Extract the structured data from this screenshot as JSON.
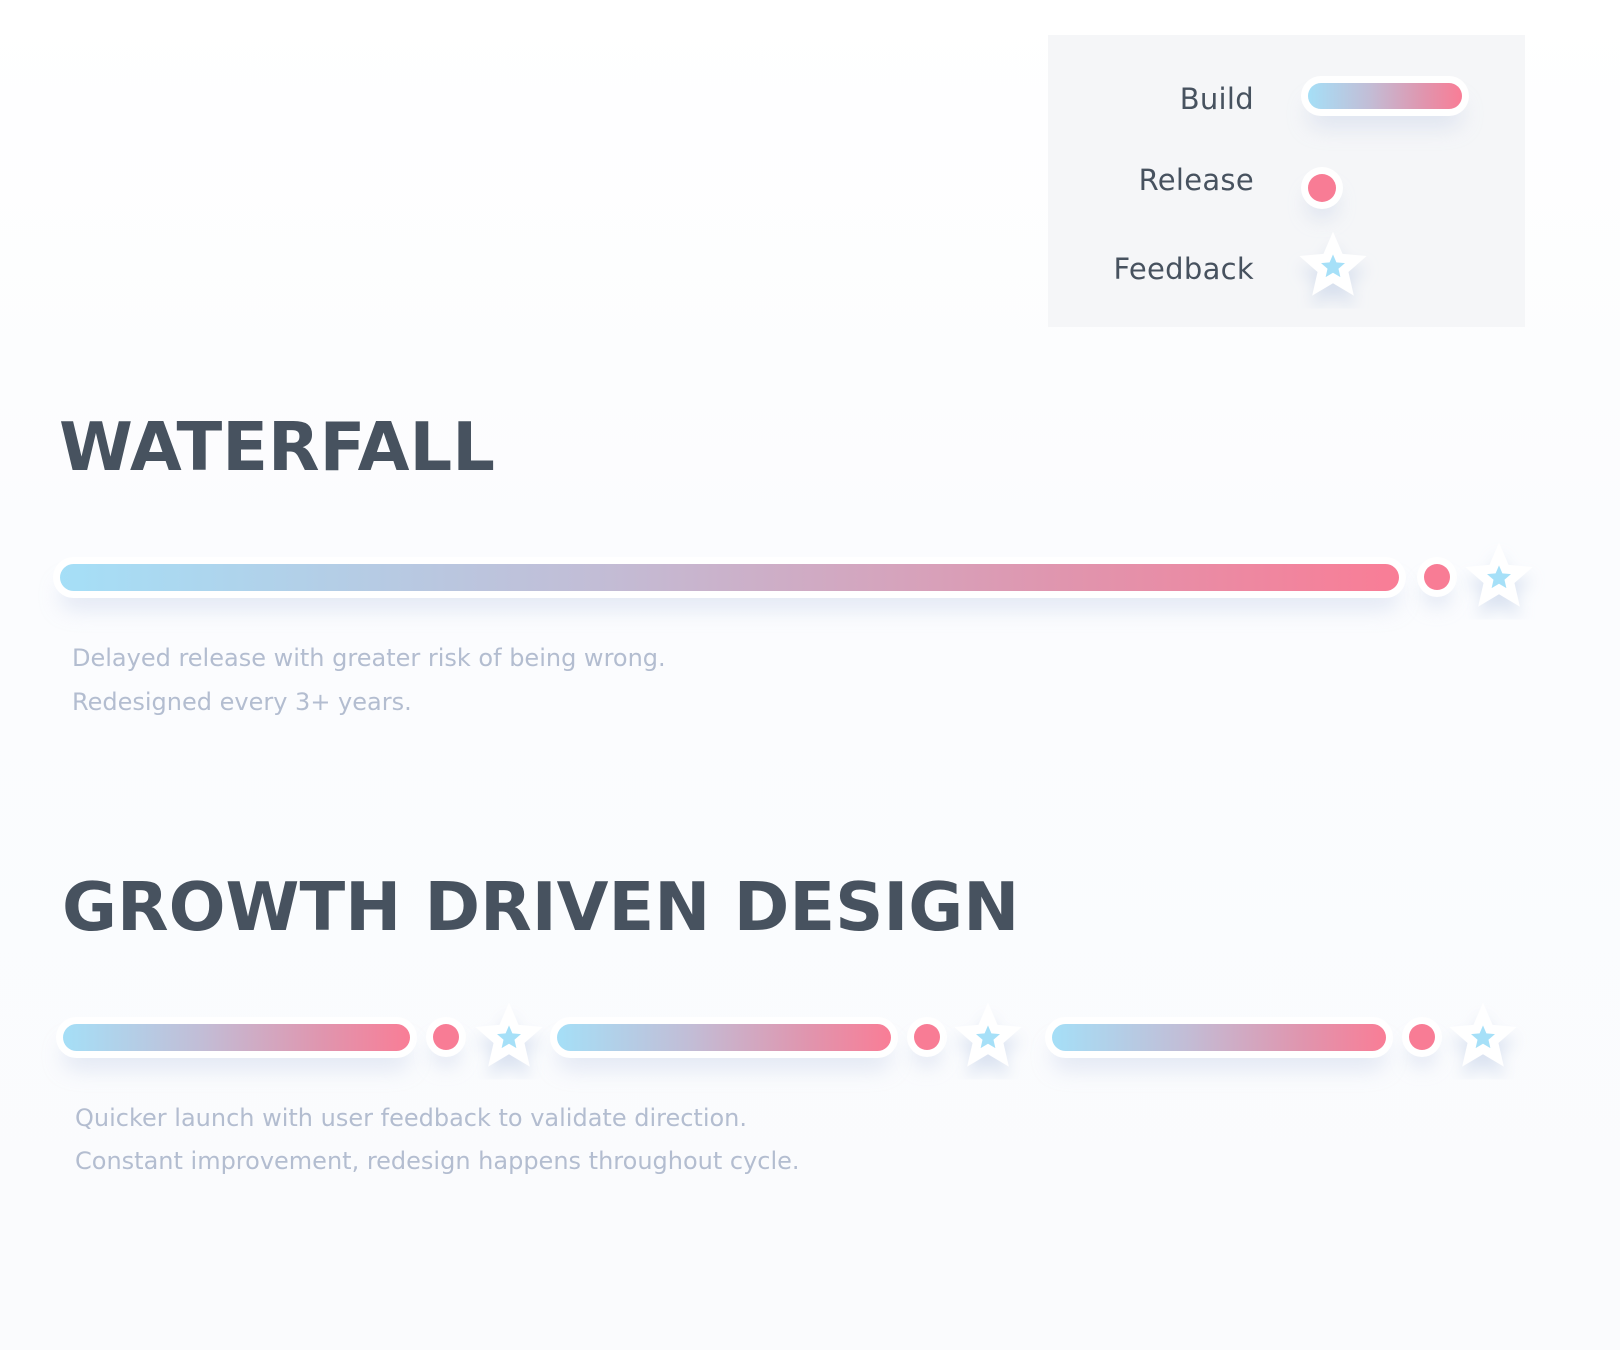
{
  "legend": {
    "items": [
      {
        "label": "Build",
        "marker": "gradient-bar"
      },
      {
        "label": "Release",
        "marker": "dot"
      },
      {
        "label": "Feedback",
        "marker": "star-icon"
      }
    ]
  },
  "colors": {
    "build_start": "#a5dff7",
    "build_end": "#f97d96",
    "release": "#f87c95",
    "feedback": "#a6e0f8",
    "title": "#47525f",
    "description": "#b3bdd0",
    "legend_bg": "#f5f6f8"
  },
  "sections": [
    {
      "title": "WATERFALL",
      "sequence": [
        "build",
        "release",
        "feedback"
      ],
      "description": [
        "Delayed release with greater risk of being wrong.",
        "Redesigned every 3+ years."
      ]
    },
    {
      "title": "GROWTH DRIVEN DESIGN",
      "sequence": [
        "build",
        "release",
        "feedback",
        "build",
        "release",
        "feedback",
        "build",
        "release",
        "feedback"
      ],
      "description": [
        "Quicker launch with user feedback to validate direction.",
        "Constant improvement, redesign happens throughout cycle."
      ]
    }
  ]
}
